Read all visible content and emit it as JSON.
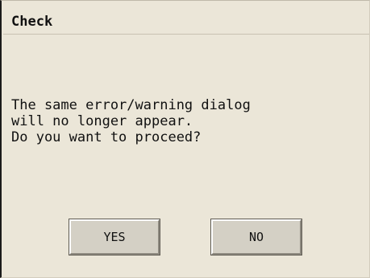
{
  "dialog": {
    "title": "Check",
    "message": "The same error/warning dialog\nwill no longer appear.\nDo you want to proceed?",
    "buttons": {
      "yes_label": "YES",
      "no_label": "NO"
    }
  }
}
